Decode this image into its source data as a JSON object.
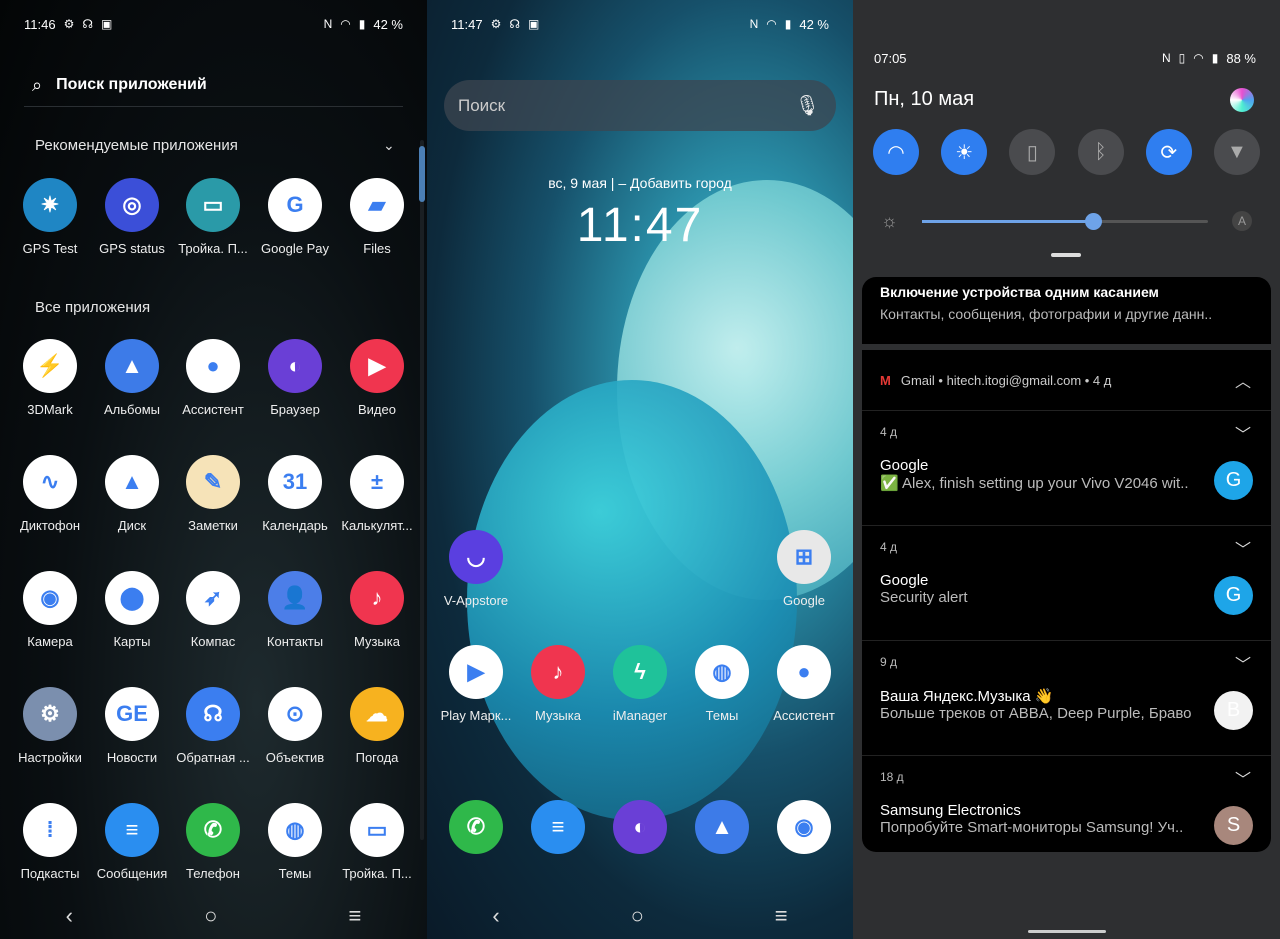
{
  "drawer": {
    "status": {
      "time": "11:46",
      "battery": "42 %"
    },
    "search_placeholder": "Поиск приложений",
    "recommended_title": "Рекомендуемые приложения",
    "all_title": "Все приложения",
    "recommended": [
      {
        "label": "GPS Test",
        "color": "#1f86c4",
        "glyph": "✷"
      },
      {
        "label": "GPS status",
        "color": "#3b4fd8",
        "glyph": "◎"
      },
      {
        "label": "Тройка. П...",
        "color": "#2a9aa8",
        "glyph": "▭"
      },
      {
        "label": "Google Pay",
        "color": "#ffffff",
        "glyph": "G"
      },
      {
        "label": "Files",
        "color": "#ffffff",
        "glyph": "▰"
      }
    ],
    "apps": [
      {
        "label": "3DMark",
        "color": "#ffffff",
        "glyph": "⚡"
      },
      {
        "label": "Альбомы",
        "color": "#3d7be8",
        "glyph": "▲"
      },
      {
        "label": "Ассистент",
        "color": "#ffffff",
        "glyph": "●"
      },
      {
        "label": "Браузер",
        "color": "#6a3fd6",
        "glyph": "◐"
      },
      {
        "label": "Видео",
        "color": "#f0354f",
        "glyph": "▶"
      },
      {
        "label": "Диктофон",
        "color": "#ffffff",
        "glyph": "∿"
      },
      {
        "label": "Диск",
        "color": "#ffffff",
        "glyph": "▲"
      },
      {
        "label": "Заметки",
        "color": "#f6e3b8",
        "glyph": "✎"
      },
      {
        "label": "Календарь",
        "color": "#ffffff",
        "glyph": "31"
      },
      {
        "label": "Калькулят...",
        "color": "#ffffff",
        "glyph": "±"
      },
      {
        "label": "Камера",
        "color": "#ffffff",
        "glyph": "◉"
      },
      {
        "label": "Карты",
        "color": "#ffffff",
        "glyph": "⬤"
      },
      {
        "label": "Компас",
        "color": "#ffffff",
        "glyph": "➶"
      },
      {
        "label": "Контакты",
        "color": "#4c7ee8",
        "glyph": "👤"
      },
      {
        "label": "Музыка",
        "color": "#f0354f",
        "glyph": "♪"
      },
      {
        "label": "Настройки",
        "color": "#7b8fae",
        "glyph": "⚙"
      },
      {
        "label": "Новости",
        "color": "#ffffff",
        "glyph": "GE"
      },
      {
        "label": "Обратная ...",
        "color": "#3b7ef0",
        "glyph": "☊"
      },
      {
        "label": "Объектив",
        "color": "#ffffff",
        "glyph": "⊙"
      },
      {
        "label": "Погода",
        "color": "#f7b21f",
        "glyph": "☁"
      },
      {
        "label": "Подкасты",
        "color": "#ffffff",
        "glyph": "⁞"
      },
      {
        "label": "Сообщения",
        "color": "#2a8ef0",
        "glyph": "≡"
      },
      {
        "label": "Телефон",
        "color": "#2fb84a",
        "glyph": "✆"
      },
      {
        "label": "Темы",
        "color": "#ffffff",
        "glyph": "◍"
      },
      {
        "label": "Тройка. П...",
        "color": "#ffffff",
        "glyph": "▭"
      }
    ]
  },
  "home": {
    "status": {
      "time": "11:47",
      "battery": "42 %"
    },
    "search_placeholder": "Поиск",
    "date": "вс, 9 мая",
    "add_city": "Добавить город",
    "clock": "11:47",
    "row1": [
      {
        "label": "V-Appstore",
        "color": "#5a3fe0",
        "glyph": "◡"
      },
      {
        "label": "Google",
        "color": "#e8e8e8",
        "glyph": "⊞"
      }
    ],
    "row2": [
      {
        "label": "Play Марк...",
        "color": "#ffffff",
        "glyph": "▶"
      },
      {
        "label": "Музыка",
        "color": "#f0354f",
        "glyph": "♪"
      },
      {
        "label": "iManager",
        "color": "#1fc29a",
        "glyph": "ϟ"
      },
      {
        "label": "Темы",
        "color": "#ffffff",
        "glyph": "◍"
      },
      {
        "label": "Ассистент",
        "color": "#ffffff",
        "glyph": "●"
      }
    ],
    "dock": [
      {
        "label": "",
        "color": "#2fb84a",
        "glyph": "✆"
      },
      {
        "label": "",
        "color": "#2a8ef0",
        "glyph": "≡"
      },
      {
        "label": "",
        "color": "#6a3fd6",
        "glyph": "◐"
      },
      {
        "label": "",
        "color": "#3d7be8",
        "glyph": "▲"
      },
      {
        "label": "",
        "color": "#ffffff",
        "glyph": "◉"
      }
    ]
  },
  "shade": {
    "status": {
      "time": "07:05",
      "battery": "88 %"
    },
    "date": "Пн, 10 мая",
    "accent": "#2f7ef0",
    "toggles": [
      {
        "icon": "wifi-icon",
        "glyph": "◠",
        "on": true
      },
      {
        "icon": "brightness-auto-icon",
        "glyph": "☀",
        "on": true
      },
      {
        "icon": "sim-off-icon",
        "glyph": "▯",
        "on": false
      },
      {
        "icon": "bluetooth-icon",
        "glyph": "ᛒ",
        "on": false
      },
      {
        "icon": "auto-rotate-icon",
        "glyph": "⟳",
        "on": true
      },
      {
        "icon": "flashlight-icon",
        "glyph": "▼",
        "on": false
      }
    ],
    "brightness_percent": 60,
    "brightness_auto": "A",
    "nearby": {
      "title": "Включение устройства одним касанием",
      "text": "Контакты, сообщения, фотографии и другие данн.."
    },
    "gmail_header": "Gmail • hitech.itogi@gmail.com • 4 д",
    "notifications": [
      {
        "ago": "4 д",
        "title": "Google",
        "text": "✅ Alex, finish setting up your Vivo V2046 wit..",
        "avatar": "G",
        "color": "#1ea5e8"
      },
      {
        "ago": "4 д",
        "title": "Google",
        "text": "Security alert",
        "avatar": "G",
        "color": "#1ea5e8"
      },
      {
        "ago": "9 д",
        "title": "Ваша Яндекс.Музыка 👋",
        "text": "Больше треков от ABBA, Deep Purple, Браво",
        "avatar": "B",
        "color": "#f2f2f2"
      },
      {
        "ago": "18 д",
        "title": "Samsung Electronics",
        "text": "Попробуйте Smart-мониторы Samsung! Уч..",
        "avatar": "S",
        "color": "#a8877c"
      }
    ]
  }
}
